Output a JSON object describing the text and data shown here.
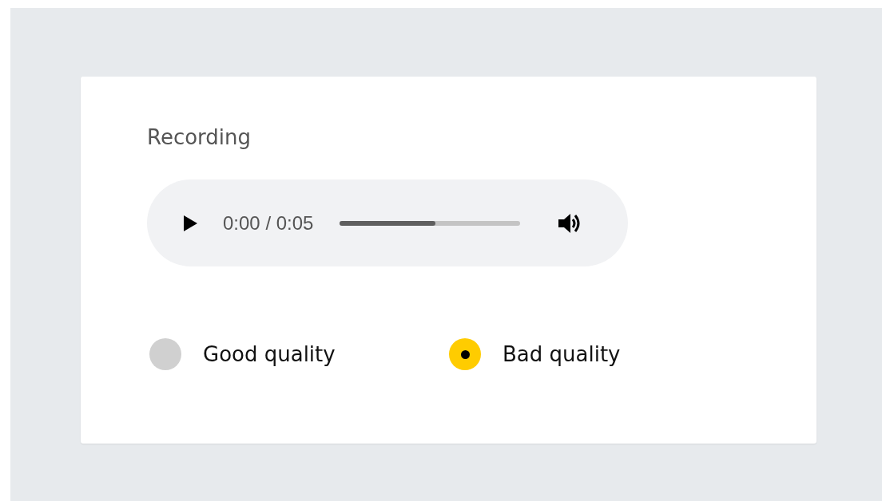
{
  "title": "Recording",
  "player": {
    "time": "0:00 / 0:05",
    "level": 0.53,
    "playing": false
  },
  "options": [
    {
      "label": "Good quality",
      "selected": false
    },
    {
      "label": "Bad quality",
      "selected": true
    }
  ]
}
